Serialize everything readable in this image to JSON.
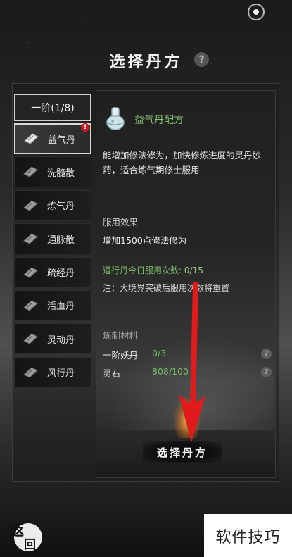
{
  "header": {
    "title": "选择丹方",
    "help_symbol": "?"
  },
  "tier_button": {
    "label": "一阶(1/8)"
  },
  "pills": [
    {
      "label": "益气丹",
      "selected": true,
      "alert": "!"
    },
    {
      "label": "洗髓散"
    },
    {
      "label": "炼气丹"
    },
    {
      "label": "通脉散"
    },
    {
      "label": "疏经丹"
    },
    {
      "label": "活血丹"
    },
    {
      "label": "灵动丹"
    },
    {
      "label": "风行丹"
    }
  ],
  "detail": {
    "recipe_name": "益气丹配方",
    "description": "能增加修法修为，加快修炼进度的灵丹妙药，适合炼气期修士服用",
    "effect_label": "服用效果",
    "effect_value": "增加1500点修法修为",
    "daily_label": "道行丹今日服用次数:",
    "daily_count": "0/15",
    "note": "注：大境界突破后服用次数将重置",
    "materials_label": "炼制材料",
    "materials": [
      {
        "name": "一阶妖丹",
        "count": "0/3",
        "help": "?"
      },
      {
        "name": "灵石",
        "count": "808/100",
        "help": "?"
      }
    ]
  },
  "select_button": {
    "label": "选择丹方"
  },
  "back_button": {
    "char1": "返",
    "char2": "回"
  },
  "watermark": {
    "text": "软件技巧"
  },
  "colors": {
    "accent_green": "#8ac874",
    "arrow_red": "#e11b1b",
    "alert_red": "#c21b1b"
  }
}
